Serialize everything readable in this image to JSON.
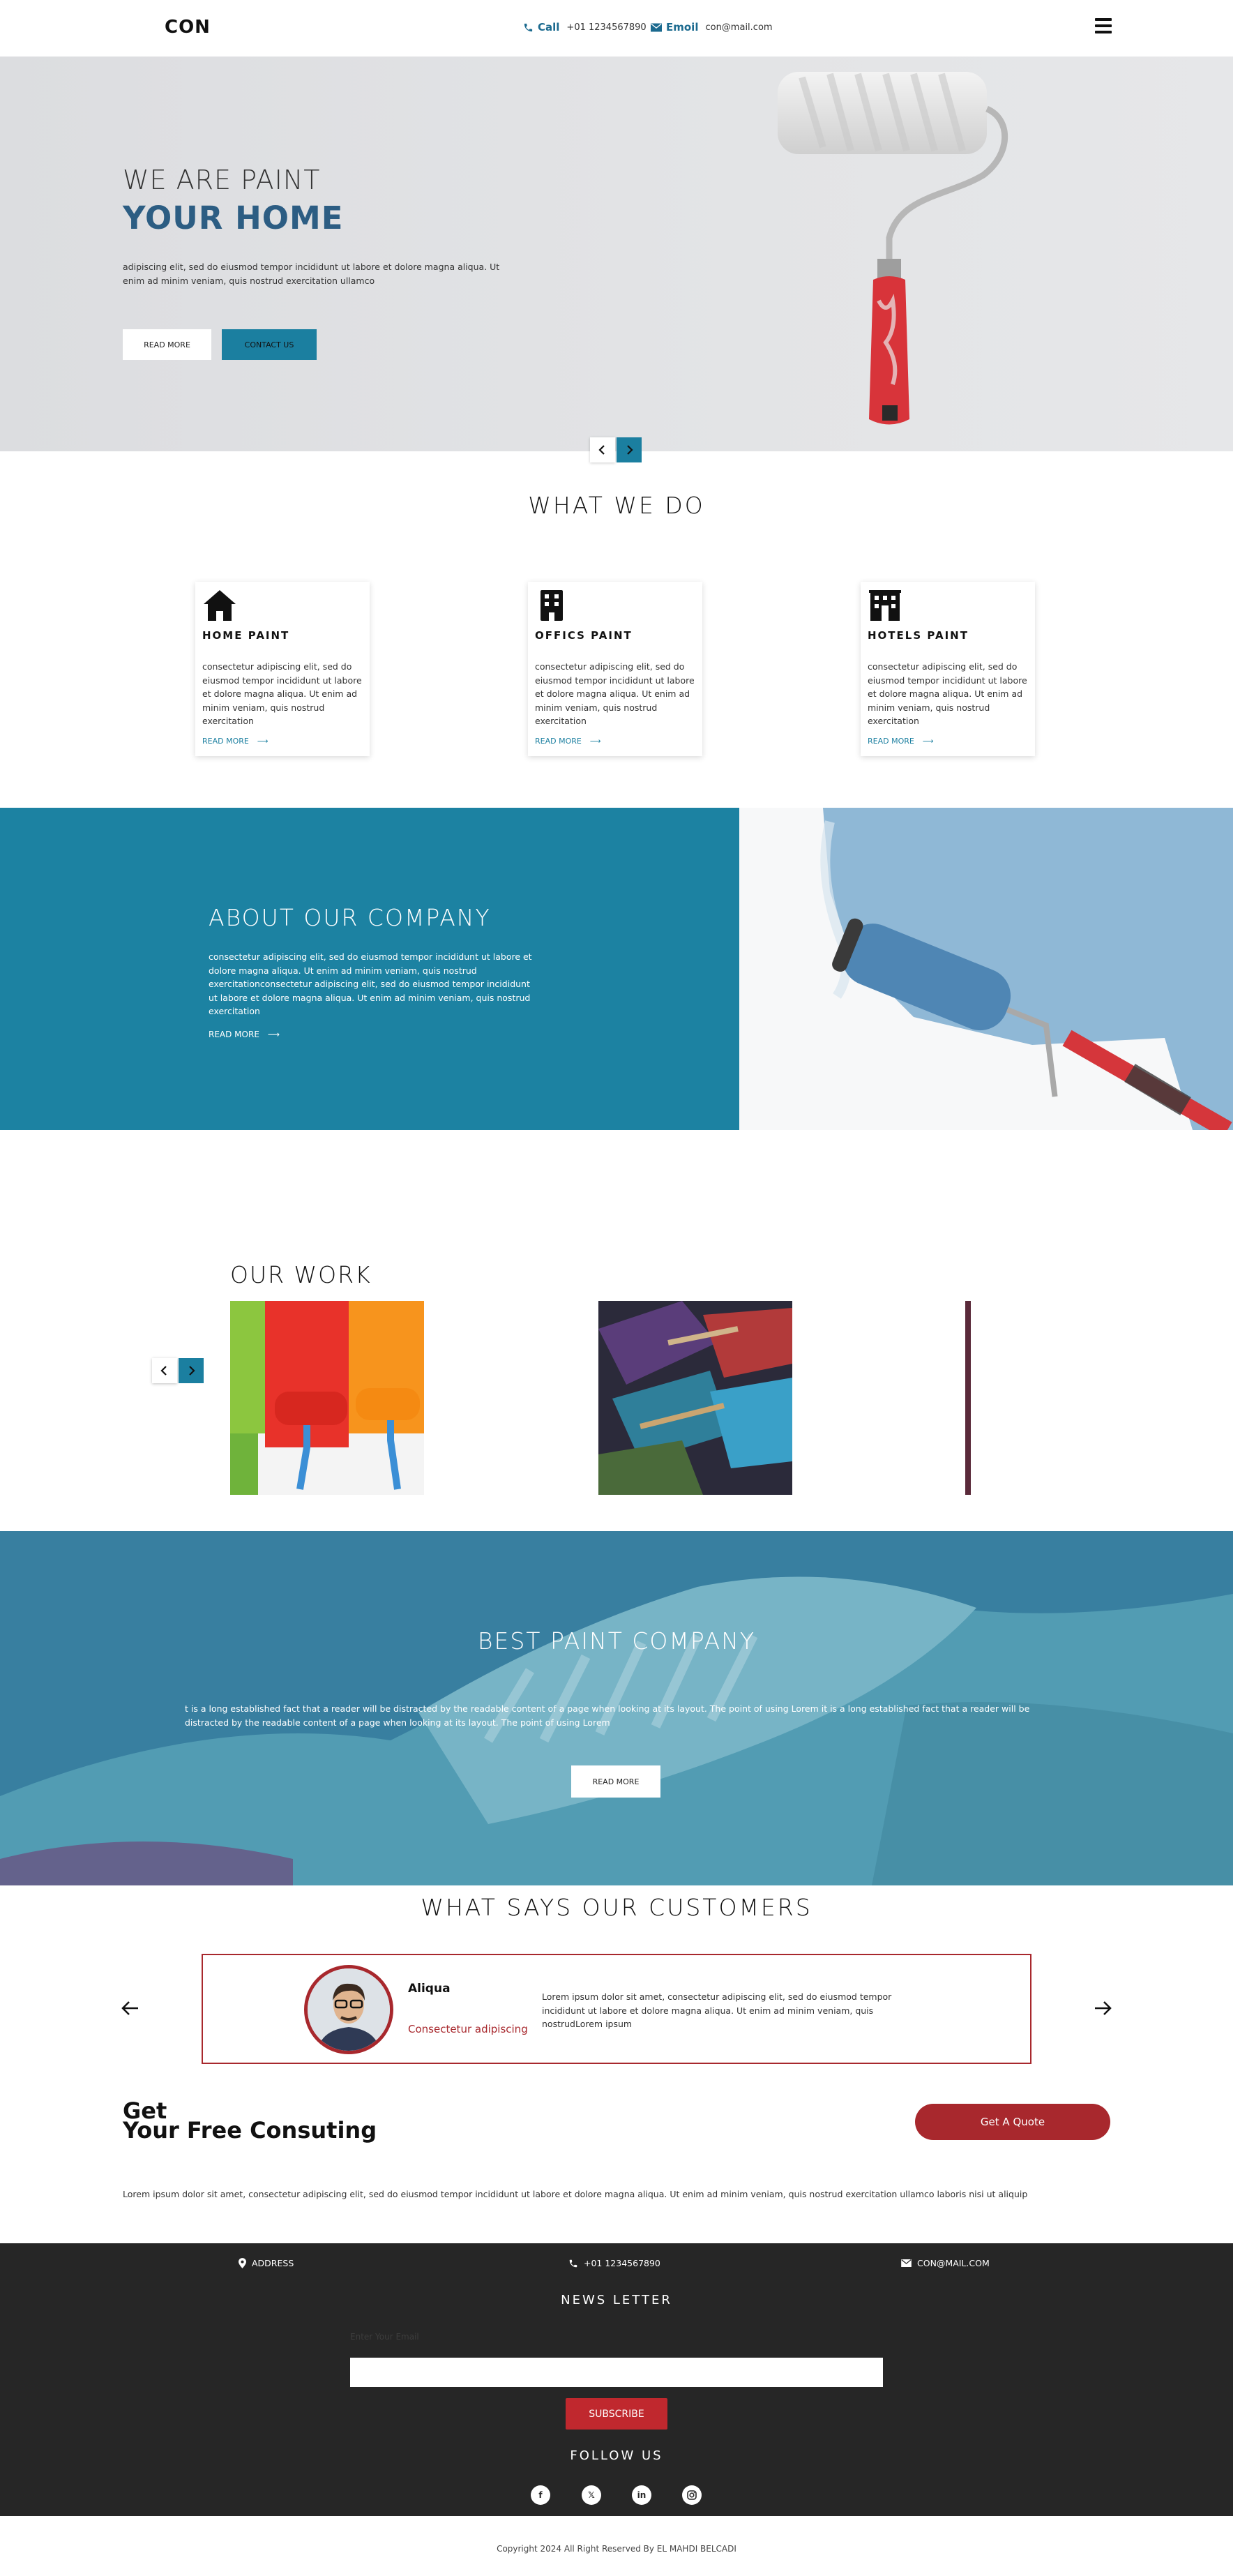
{
  "header": {
    "logo": "CON",
    "call_label": "Call",
    "call_value": "+01 1234567890",
    "email_label": "Emoil",
    "email_value": "con@mail.com"
  },
  "hero": {
    "line1": "WE ARE PAINT",
    "line2": "YOUR HOME",
    "text": "adipiscing elit, sed do eiusmod tempor incididunt ut labore et dolore magna aliqua. Ut enim ad minim veniam, quis nostrud exercitation ullamco",
    "btn_read": "READ MORE",
    "btn_contact": "CONTACT US"
  },
  "what_we_do": {
    "title": "WHAT WE DO",
    "cards": [
      {
        "icon": "home-icon",
        "title": "HOME PAINT",
        "text": "consectetur adipiscing elit, sed do eiusmod tempor incididunt ut labore et dolore magna aliqua. Ut enim ad minim veniam, quis nostrud exercitation",
        "more": "READ MORE"
      },
      {
        "icon": "building-icon",
        "title": "OFFICS PAINT",
        "text": "consectetur adipiscing elit, sed do eiusmod tempor incididunt ut labore et dolore magna aliqua. Ut enim ad minim veniam, quis nostrud exercitation",
        "more": "READ MORE"
      },
      {
        "icon": "hotel-icon",
        "title": "HOTELS PAINT",
        "text": "consectetur adipiscing elit, sed do eiusmod tempor incididunt ut labore et dolore magna aliqua. Ut enim ad minim veniam, quis nostrud exercitation",
        "more": "READ MORE"
      }
    ]
  },
  "about": {
    "title": "ABOUT OUR COMPANY",
    "text": "consectetur adipiscing elit, sed do eiusmod tempor incididunt ut labore et dolore magna aliqua. Ut enim ad minim veniam, quis nostrud exercitationconsectetur adipiscing elit, sed do eiusmod tempor incididunt ut labore et dolore magna aliqua. Ut enim ad minim veniam, quis nostrud exercitation",
    "more": "READ MORE"
  },
  "work": {
    "title": "OUR WORK"
  },
  "best": {
    "title": "BEST PAINT COMPANY",
    "text": "t is a long established fact that a reader will be distracted by the readable content of a page when looking at its layout. The point of using Lorem it is a long established fact that a reader will be distracted by the readable content of a page when looking at its layout. The point of using Lorem",
    "btn": "READ MORE"
  },
  "customers": {
    "title": "WHAT SAYS OUR CUSTOMERS",
    "name": "Aliqua",
    "role": "Consectetur adipiscing",
    "quote": "Lorem ipsum dolor sit amet, consectetur adipiscing elit, sed do eiusmod tempor incididunt ut labore et dolore magna aliqua. Ut enim ad minim veniam, quis nostrudLorem ipsum"
  },
  "consult": {
    "title_line1": "Get",
    "title_line2": "Your Free Consuting",
    "btn": "Get A Quote",
    "text": "Lorem ipsum dolor sit amet, consectetur adipiscing elit, sed do eiusmod tempor incididunt ut labore et dolore magna aliqua. Ut enim ad minim veniam, quis nostrud exercitation ullamco laboris nisi ut aliquip"
  },
  "footer": {
    "address": "ADDRESS",
    "phone": "+01 1234567890",
    "email": "CON@MAIL.COM",
    "news_title": "NEWS LETTER",
    "news_placeholder": "Enter Your Email",
    "subscribe": "SUBSCRIBE",
    "follow_title": "FOLLOW US",
    "socials": [
      "facebook-icon",
      "x-icon",
      "linkedin-icon",
      "instagram-icon"
    ],
    "copyright": "Copyright 2024 All Right Reserved By EL MAHDI BELCADI"
  },
  "colors": {
    "accent": "#1b7fa0",
    "brand_dark": "#2c5d83",
    "red": "#a8282d",
    "footer_bg": "#262626"
  }
}
